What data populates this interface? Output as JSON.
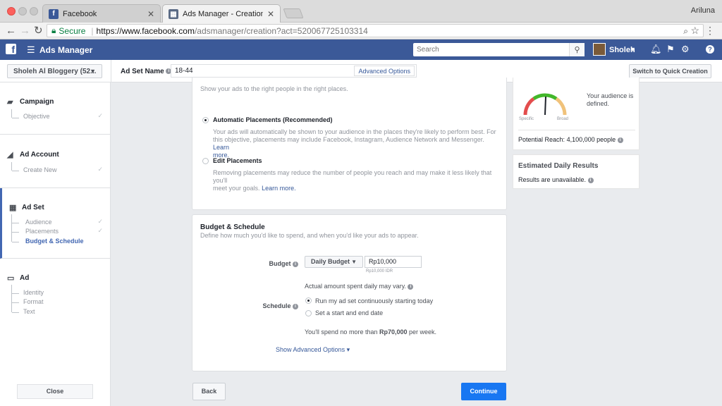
{
  "browser": {
    "tabs": [
      {
        "label": "Facebook",
        "close": "✕"
      },
      {
        "label": "Ads Manager - Creation",
        "close": "✕"
      }
    ],
    "profile": "Ariluna",
    "secure_label": "Secure",
    "url_host": "https://www.facebook.com",
    "url_path": "/adsmanager/creation?act=520067725103314"
  },
  "topbar": {
    "title": "Ads Manager",
    "search_placeholder": "Search",
    "user": "Sholeh"
  },
  "subheader": {
    "account": "Sholeh Al Bloggery (52...",
    "adset_label": "Ad Set Name",
    "adset_value": "18-44",
    "advanced_options": "Advanced Options",
    "quick_creation": "Switch to Quick Creation"
  },
  "sidebar": {
    "campaign": {
      "title": "Campaign",
      "items": [
        "Objective"
      ]
    },
    "ad_account": {
      "title": "Ad Account",
      "items": [
        "Create New"
      ]
    },
    "ad_set": {
      "title": "Ad Set",
      "items": [
        "Audience",
        "Placements",
        "Budget & Schedule"
      ]
    },
    "ad": {
      "title": "Ad",
      "items": [
        "Identity",
        "Format",
        "Text"
      ]
    },
    "close": "Close"
  },
  "placements": {
    "subtitle": "Show your ads to the right people in the right places.",
    "auto_title": "Automatic Placements (Recommended)",
    "auto_desc_1": "Your ads will automatically be shown to your audience in the places they're likely to perform best. For",
    "auto_desc_2": "this objective, placements may include Facebook, Instagram, Audience Network and Messenger.",
    "learn_more_a": "Learn",
    "learn_more_b": "more.",
    "edit_title": "Edit Placements",
    "edit_desc_1": "Removing placements may reduce the number of people you reach and may make it less likely that you'll",
    "edit_desc_2": "meet your goals.",
    "learn_more_c": "Learn more."
  },
  "budget": {
    "title": "Budget & Schedule",
    "subtitle": "Define how much you'd like to spend, and when you'd like your ads to appear.",
    "budget_label": "Budget",
    "budget_type": "Daily Budget",
    "budget_value": "Rp10,000",
    "budget_hint": "Rp10,000 IDR",
    "actual_note": "Actual amount spent daily may vary.",
    "schedule_label": "Schedule",
    "opt_continuous": "Run my ad set continuously starting today",
    "opt_startend": "Set a start and end date",
    "spend_prefix": "You'll spend no more than ",
    "spend_amount": "Rp70,000",
    "spend_suffix": " per week.",
    "show_advanced": "Show Advanced Options ▾"
  },
  "footer": {
    "back": "Back",
    "continue": "Continue"
  },
  "audience": {
    "defined": "Your audience is defined.",
    "specific": "Specific",
    "broad": "Broad",
    "reach_label": "Potential Reach:",
    "reach_value": "4,100,000 people"
  },
  "estimated": {
    "title": "Estimated Daily Results",
    "text": "Results are unavailable."
  },
  "colors": {
    "fb_blue": "#3b5998",
    "accent": "#4267b2",
    "cta": "#1877f2"
  }
}
